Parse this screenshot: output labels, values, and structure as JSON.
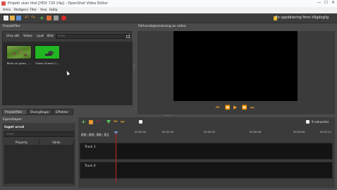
{
  "window": {
    "title": "Projekt utan titel [HDV 720 24p] - OpenShot Video Editor",
    "controls": {
      "minimize": "—",
      "maximize": "☐",
      "close": "✕"
    }
  },
  "menu": [
    "Arkiv",
    "Redigera",
    "Titel",
    "Visa",
    "Hjälp"
  ],
  "toolbar": {
    "icons": [
      "new-project-icon",
      "open-project-icon",
      "save-project-icon",
      "undo-icon",
      "redo-icon",
      "import-files-icon",
      "profile-icon",
      "full-screen-icon",
      "export-video-icon"
    ],
    "update_notice": "En uppdatering finns tillgänglig"
  },
  "project_files": {
    "title": "Projektfiler",
    "filter_tabs": [
      "Visa allt",
      "Video",
      "Ljud",
      "Bild"
    ],
    "filter_placeholder": "Filter",
    "files": [
      {
        "name": "Birds on grass - ..."
      },
      {
        "name": "Green Screen C..."
      }
    ]
  },
  "preview": {
    "title": "Förhandsgranskning av video",
    "buttons": [
      "⏮",
      "⏪",
      "▶",
      "⏩",
      "⏭"
    ]
  },
  "bottom_tabs": [
    "Projektfiler",
    "Övergångar",
    "Effekter"
  ],
  "properties": {
    "title": "Egenskaper",
    "selection": "Inget urval",
    "filter_placeholder": "Filter",
    "columns": [
      "Property",
      "Värde"
    ]
  },
  "timeline": {
    "duration_label": "9 sekunder",
    "zoom_value": "",
    "current_time": "00:00:00:01",
    "ruler_ticks": [
      "00:00:00",
      "00:00:16",
      "00:00:32",
      "00:00:48",
      "00:00:64",
      "00:01:12"
    ],
    "tracks": [
      {
        "name": "Track 1"
      },
      {
        "name": "Track 0"
      }
    ]
  },
  "colors": {
    "accent_orange": "#e79a2d",
    "playhead": "#c41d1d",
    "grass_green": "#5a8f2c",
    "screen_green": "#1fb51f"
  }
}
